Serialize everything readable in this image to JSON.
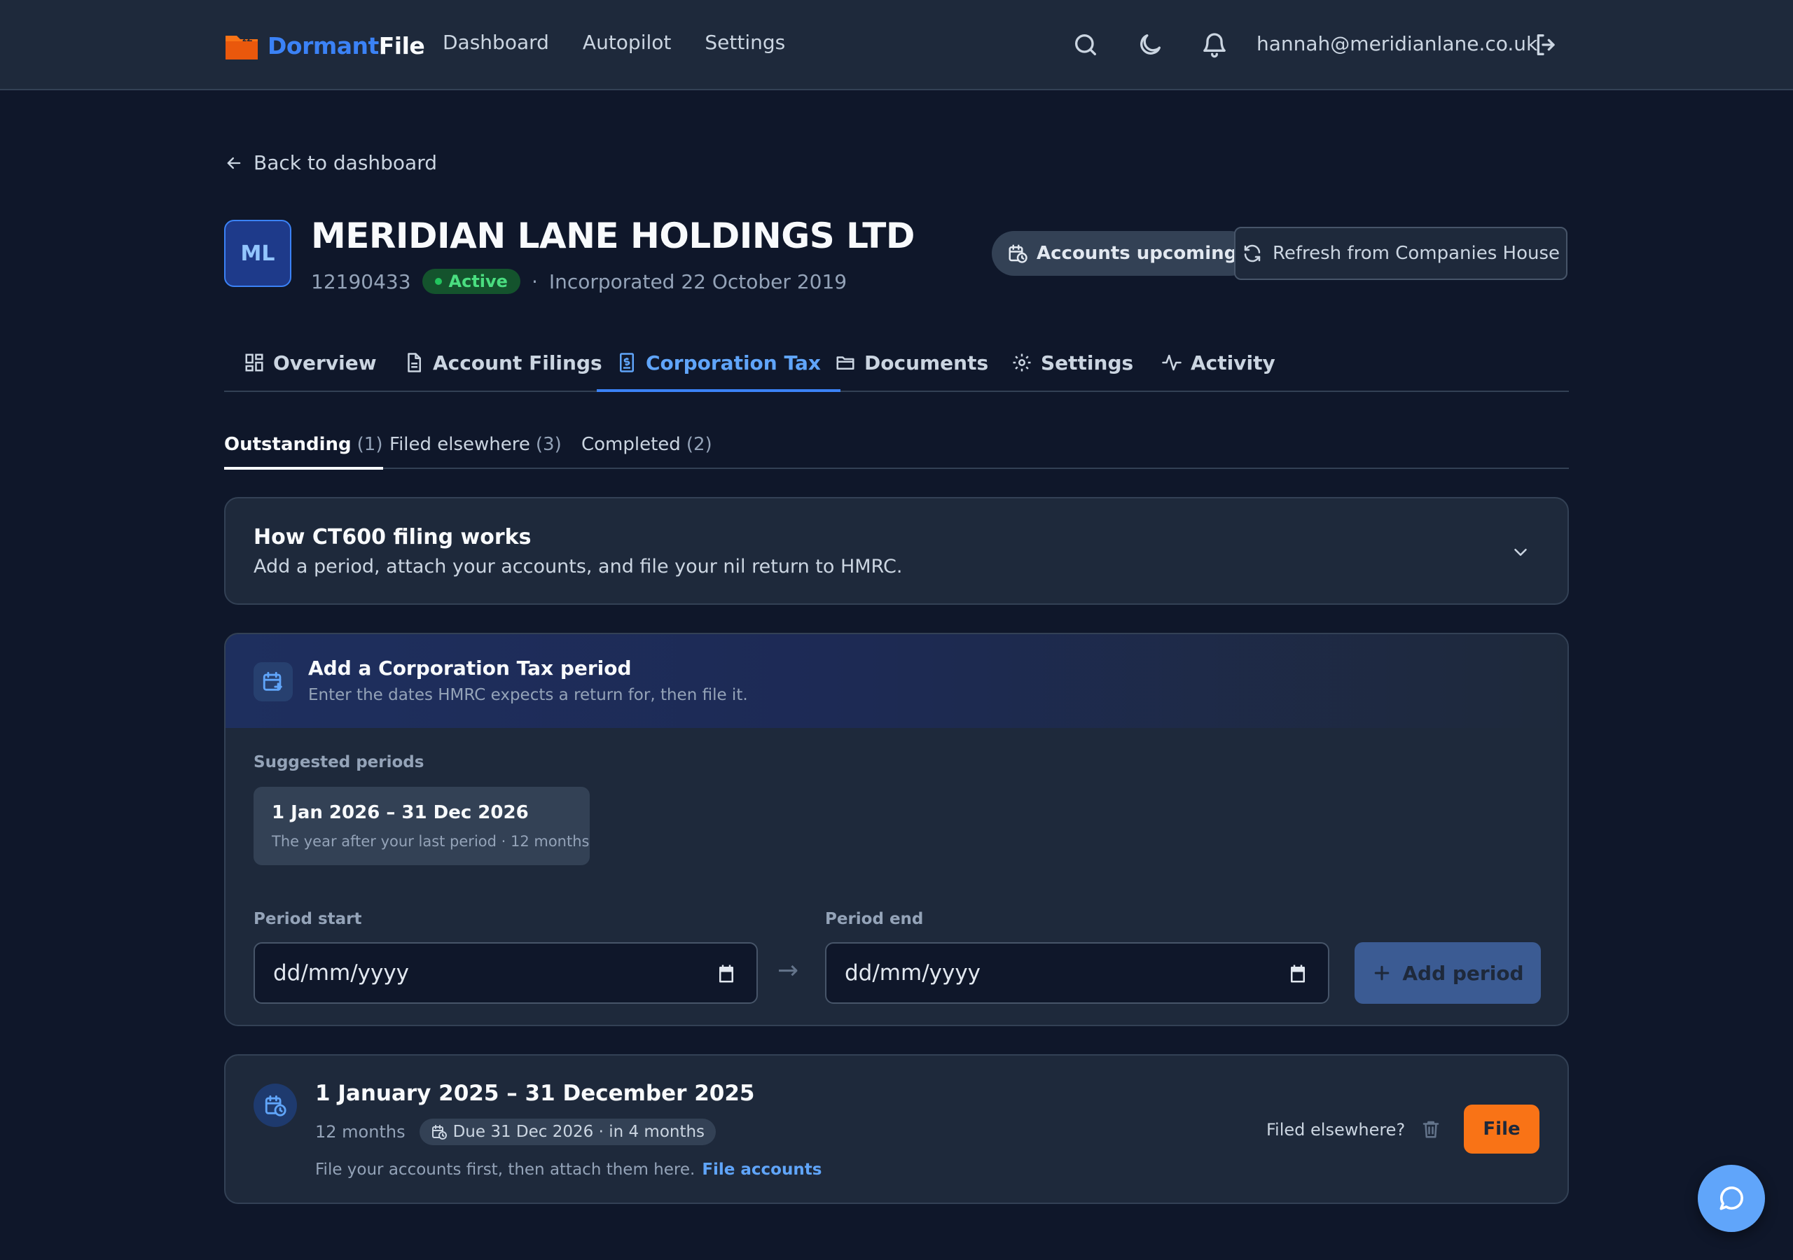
{
  "header": {
    "logo_part1": "Dormant",
    "logo_part2": "File",
    "nav": [
      "Dashboard",
      "Autopilot",
      "Settings"
    ],
    "user_email": "hannah@meridianlane.co.uk"
  },
  "back_label": "Back to dashboard",
  "company": {
    "initials": "ML",
    "name": "MERIDIAN LANE HOLDINGS LTD",
    "number": "12190433",
    "status": "Active",
    "separator": "·",
    "incorporated": "Incorporated 22 October 2019"
  },
  "actions": {
    "accounts_badge": "Accounts upcoming",
    "refresh": "Refresh from Companies House"
  },
  "tabs": [
    "Overview",
    "Account Filings",
    "Corporation Tax",
    "Documents",
    "Settings",
    "Activity"
  ],
  "active_tab": "Corporation Tax",
  "subtabs": [
    {
      "label": "Outstanding",
      "count": "(1)"
    },
    {
      "label": "Filed elsewhere",
      "count": "(3)"
    },
    {
      "label": "Completed",
      "count": "(2)"
    }
  ],
  "info": {
    "title": "How CT600 filing works",
    "subtitle": "Add a period, attach your accounts, and file your nil return to HMRC."
  },
  "add_period": {
    "title": "Add a Corporation Tax period",
    "subtitle": "Enter the dates HMRC expects a return for, then file it.",
    "suggested_label": "Suggested periods",
    "suggestion_main": "1 Jan 2026 – 31 Dec 2026",
    "suggestion_detail": "The year after your last period · 12 months",
    "start_label": "Period start",
    "end_label": "Period end",
    "date_placeholder": "dd/mm/yyyy",
    "arrow": "→",
    "add_button": "Add period"
  },
  "period": {
    "title": "1 January 2025 – 31 December 2025",
    "length": "12 months",
    "due": "Due 31 Dec 2026 · in 4 months",
    "note": "File your accounts first, then attach them here.",
    "note_link": "File accounts",
    "filed_elsewhere": "Filed elsewhere?",
    "file_button": "File"
  },
  "colors": {
    "accent": "#3b82f6",
    "file_button": "#f97316",
    "active_status": "#22c55e",
    "background": "#0f172a"
  }
}
